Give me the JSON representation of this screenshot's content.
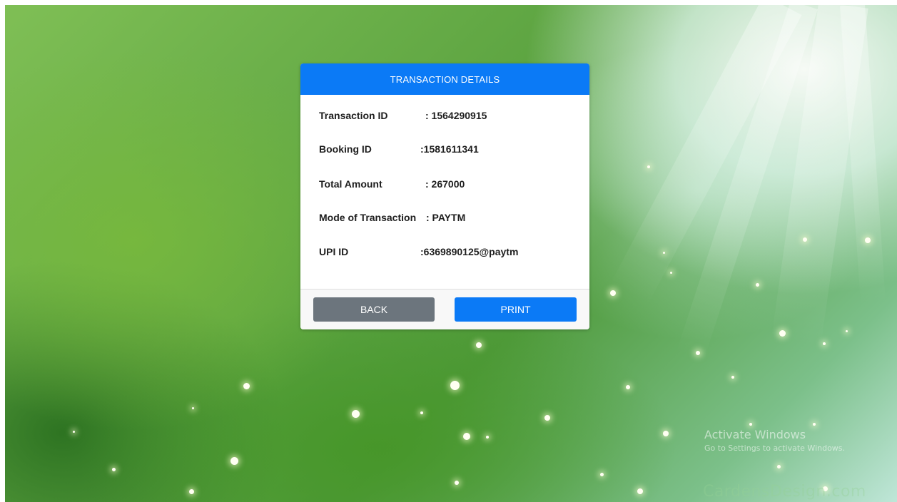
{
  "card": {
    "title": "TRANSACTION DETAILS",
    "rows": [
      {
        "label": "Transaction ID",
        "value": ": 1564290915"
      },
      {
        "label": "Booking ID",
        "value": ":1581611341"
      },
      {
        "label": "Total Amount",
        "value": ": 267000"
      },
      {
        "label": "Mode of Transaction",
        "value": ": PAYTM"
      },
      {
        "label": "UPI ID",
        "value": ":6369890125@paytm"
      }
    ],
    "back_label": "BACK",
    "print_label": "PRINT"
  },
  "watermark": {
    "title": "Activate Windows",
    "subtitle": "Go to Settings to activate Windows."
  },
  "background_brand": "CardensDesign.com",
  "colors": {
    "header": "#0b7af6",
    "print_button": "#0b7af6",
    "back_button": "#6c757d"
  }
}
